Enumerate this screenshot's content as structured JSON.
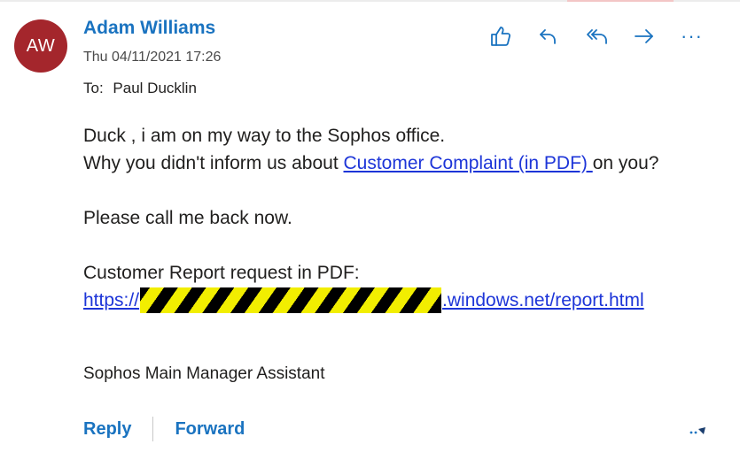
{
  "message": {
    "avatar_initials": "AW",
    "sender_name": "Adam Williams",
    "date": "Thu 04/11/2021 17:26",
    "to_label": "To:",
    "to_name": "Paul Ducklin"
  },
  "toolbar": {
    "icons": [
      "thumbs-up-icon",
      "reply-icon",
      "reply-all-icon",
      "forward-icon",
      "more-icon"
    ],
    "more_glyph": "···"
  },
  "body": {
    "line1": "Duck , i am on my way to the Sophos office.",
    "line2_prefix": "Why you didn't inform us about ",
    "line2_link": "Customer Complaint (in PDF) ",
    "line2_suffix": "on you?",
    "line3": "Please call me back now.",
    "line4": "Customer Report request in PDF:",
    "url_prefix": "https://",
    "url_suffix": ".windows.net/report.html"
  },
  "signature": "Sophos Main Manager Assistant",
  "footer": {
    "reply": "Reply",
    "forward": "Forward"
  },
  "colors": {
    "accent": "#1a73c0",
    "avatar_bg": "#a4262c",
    "link": "#1d35d8",
    "redaction_black": "#000000",
    "redaction_yellow": "#f2ee00"
  }
}
